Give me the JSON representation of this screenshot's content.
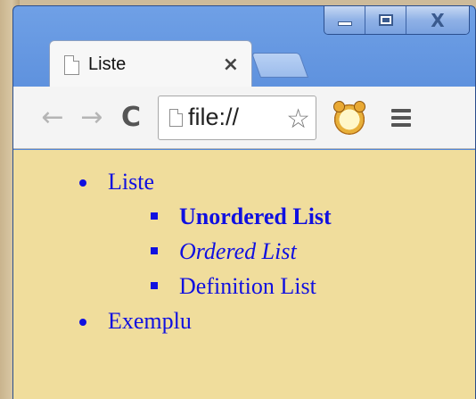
{
  "tab": {
    "title": "Liste",
    "close": "×"
  },
  "toolbar": {
    "back": "←",
    "forward": "→",
    "reload": "C",
    "address": "file://",
    "star": "☆"
  },
  "window_controls": {
    "close": "X"
  },
  "content": {
    "outer_items": [
      {
        "label": "Liste"
      },
      {
        "label": "Exemplu"
      }
    ],
    "inner_items": [
      {
        "label": "Unordered List",
        "style": "bold"
      },
      {
        "label": "Ordered List",
        "style": "italic"
      },
      {
        "label": "Definition List",
        "style": "normal"
      }
    ]
  },
  "colors": {
    "page_bg": "#f0dd9c",
    "link": "#1010e0",
    "chrome_blue": "#4f84d6"
  },
  "icons": [
    "page-icon",
    "close-icon",
    "back-arrow-icon",
    "forward-arrow-icon",
    "reload-icon",
    "star-icon",
    "alarm-clock-icon",
    "menu-icon",
    "minimize-icon",
    "maximize-icon"
  ]
}
